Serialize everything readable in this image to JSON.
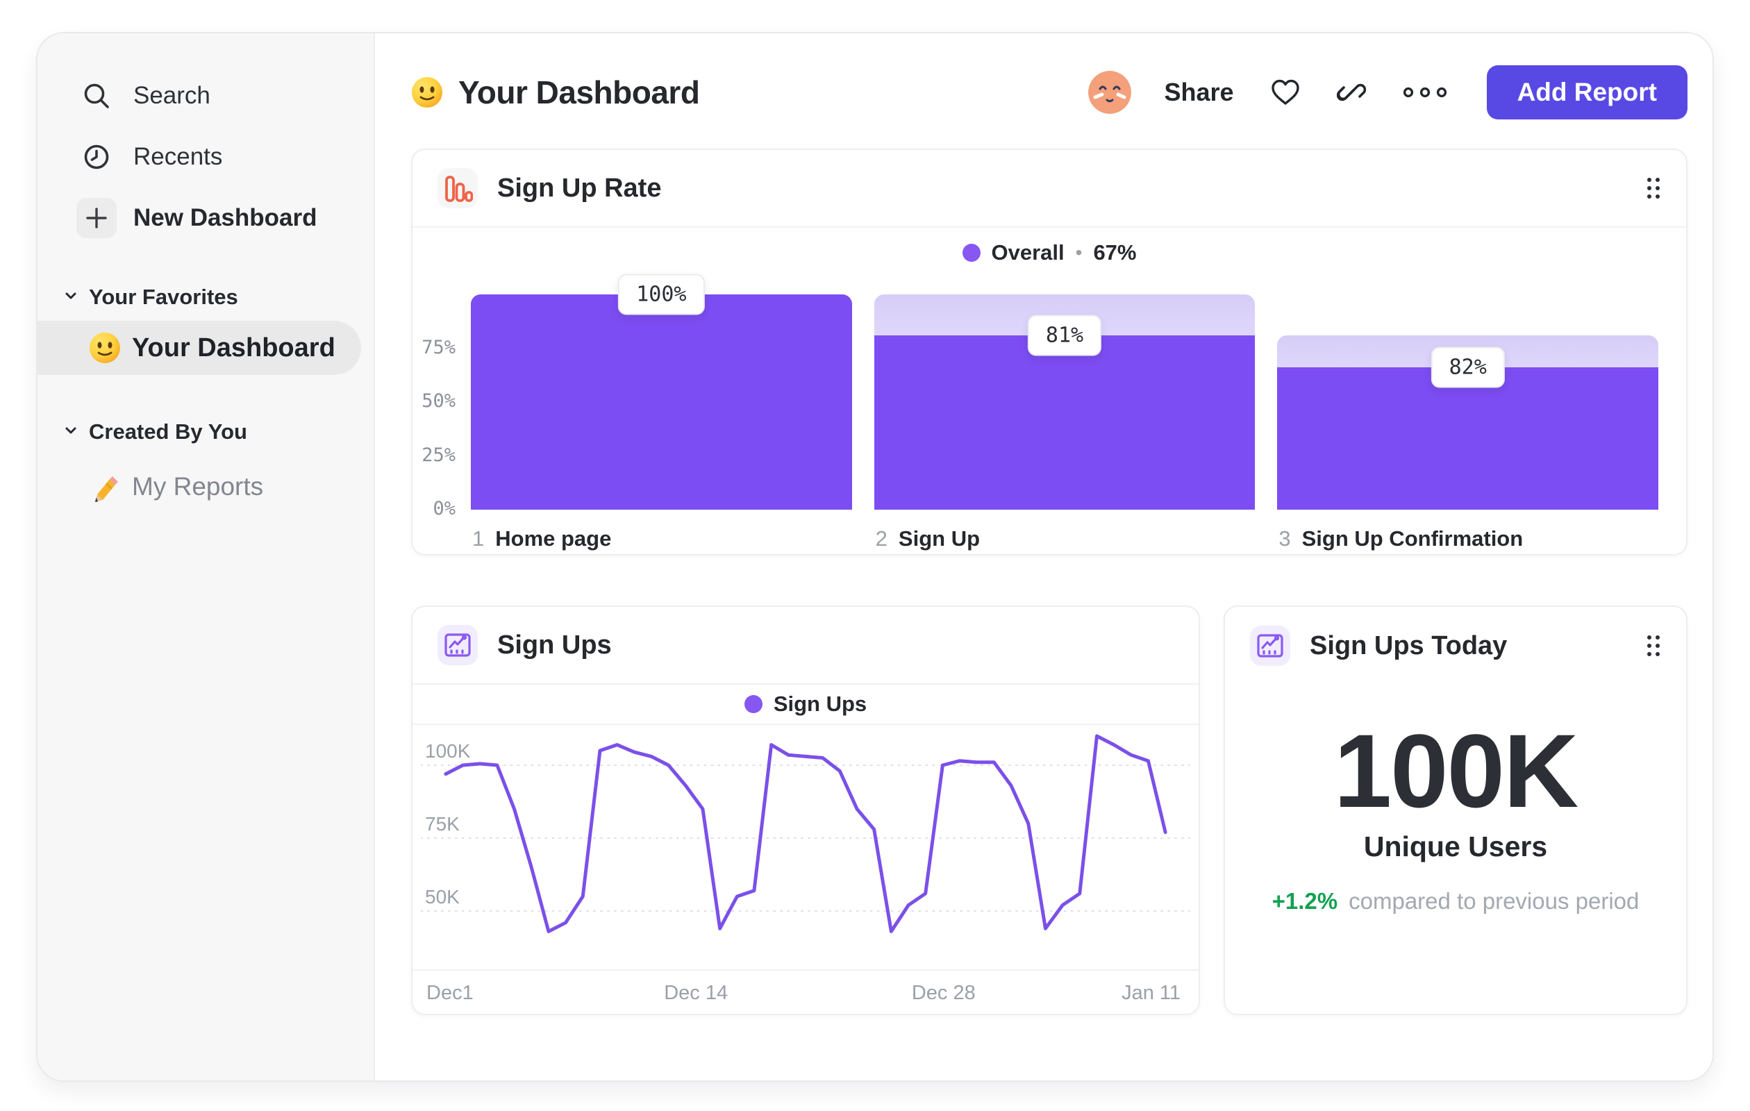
{
  "colors": {
    "bar_purple": "#7c4df2",
    "legend_dot": "#8757f2",
    "line_purple": "#7b50e8",
    "button_purple": "#5849e4",
    "orange_icon": "#ef6349",
    "green_delta": "#12a150",
    "ghost_gradient_top": "#d6cdf8",
    "ghost_gradient_bottom": "#fdfdff"
  },
  "sidebar": {
    "nav": [
      {
        "icon": "search-icon",
        "label": "Search"
      },
      {
        "icon": "clock-icon",
        "label": "Recents"
      },
      {
        "icon": "plus-icon",
        "label": "New Dashboard"
      }
    ],
    "sections": [
      {
        "label": "Your Favorites",
        "items": [
          {
            "icon": "smiley-emoji",
            "label": "Your Dashboard",
            "selected": true
          }
        ]
      },
      {
        "label": "Created By You",
        "items": [
          {
            "icon": "pencil-emoji",
            "label": "My Reports",
            "selected": false
          }
        ]
      }
    ]
  },
  "header": {
    "title": "Your Dashboard",
    "share_label": "Share",
    "add_report_label": "Add Report"
  },
  "signup_rate_card": {
    "title": "Sign Up Rate",
    "legend": {
      "label": "Overall",
      "separator": "•",
      "value": "67%"
    }
  },
  "signups_card": {
    "title": "Sign Ups",
    "legend_label": "Sign Ups"
  },
  "signups_today_card": {
    "title": "Sign Ups Today",
    "value": "100K",
    "subtitle": "Unique Users",
    "delta": "+1.2%",
    "delta_caption": "compared to previous period"
  },
  "chart_data": [
    {
      "type": "bar",
      "variant": "funnel",
      "title": "Sign Up Rate",
      "legend": "Overall • 67%",
      "overall_pct": 67,
      "categories": [
        "Home page",
        "Sign Up",
        "Sign Up Confirmation"
      ],
      "step_numbers": [
        "1",
        "2",
        "3"
      ],
      "value_labels": [
        "100%",
        "81%",
        "82%"
      ],
      "step_conversion_pct": [
        100,
        81,
        82
      ],
      "solid_pct": [
        100,
        81,
        66
      ],
      "ghost_pct": [
        100,
        100,
        81
      ],
      "y_ticks": [
        "75%",
        "50%",
        "25%",
        "0%"
      ],
      "ylim": [
        0,
        100
      ],
      "bar_color": "#7c4df2"
    },
    {
      "type": "line",
      "title": "Sign Ups",
      "legend": "Sign Ups",
      "x_ticks": [
        "Dec1",
        "Dec 14",
        "Dec 28",
        "Jan 11"
      ],
      "y_ticks": [
        "100K",
        "75K",
        "50K"
      ],
      "y_tick_values_k": [
        100,
        75,
        50
      ],
      "ylim_k": [
        38,
        113
      ],
      "grid": "dotted",
      "line_color": "#7b50e8",
      "values_k": [
        97,
        100,
        100.5,
        100,
        85,
        65,
        43,
        46,
        55,
        105,
        107,
        104.5,
        103,
        100,
        93,
        85,
        44,
        55,
        57,
        107,
        103.5,
        103,
        102.5,
        98,
        85,
        78,
        43,
        52,
        56,
        100,
        101.5,
        101,
        101,
        93,
        80,
        44,
        52,
        56,
        110,
        107,
        103.5,
        101.5,
        77
      ]
    }
  ]
}
